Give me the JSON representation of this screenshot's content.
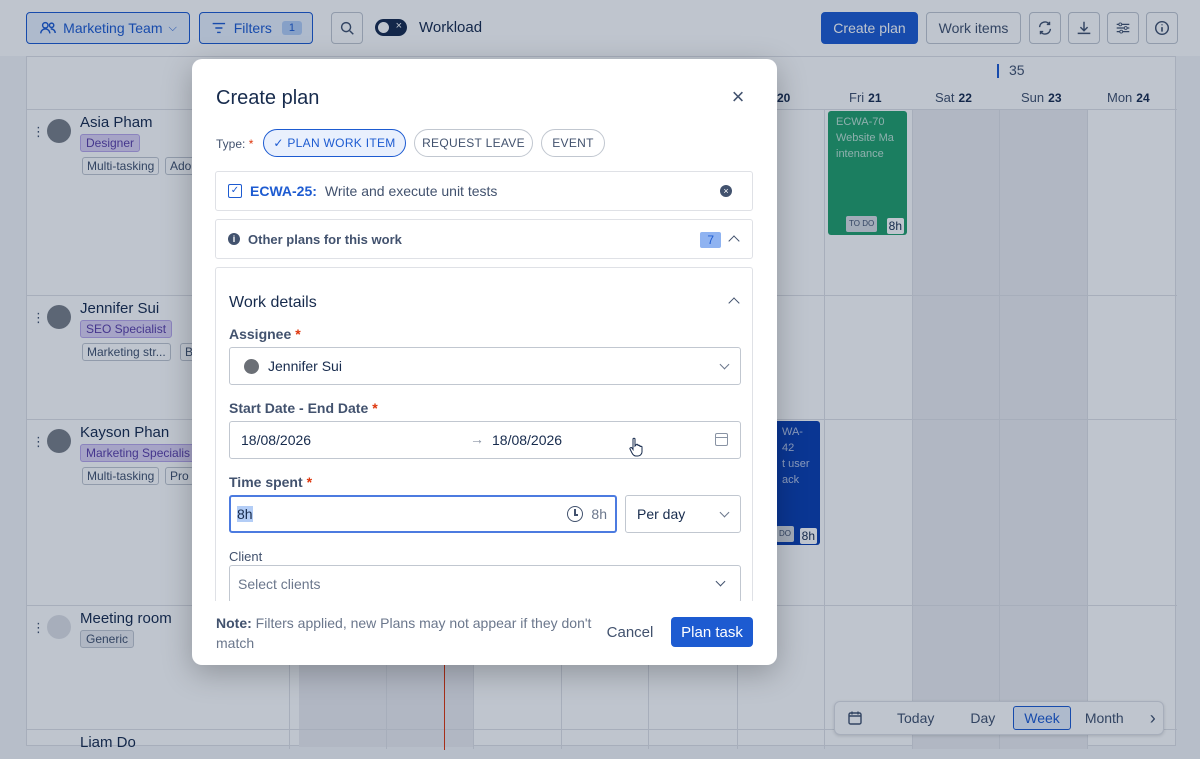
{
  "toolbar": {
    "team_label": "Marketing Team",
    "filters_label": "Filters",
    "filters_count": "1",
    "workload_label": "Workload",
    "create_plan_label": "Create plan",
    "work_items_label": "Work items"
  },
  "calendar": {
    "week_number": "35",
    "days": [
      {
        "name": "",
        "num": "20"
      },
      {
        "name": "Fri",
        "num": "21"
      },
      {
        "name": "Sat",
        "num": "22"
      },
      {
        "name": "Sun",
        "num": "23"
      },
      {
        "name": "Mon",
        "num": "24"
      }
    ],
    "people": [
      {
        "name": "Asia Pham",
        "role": "Designer",
        "skills": [
          "Multi-tasking",
          "Ado"
        ]
      },
      {
        "name": "Jennifer Sui",
        "role": "SEO Specialist",
        "skills": [
          "Marketing str...",
          "B"
        ]
      },
      {
        "name": "Kayson Phan",
        "role": "Marketing Specialis",
        "skills": [
          "Multi-tasking",
          "Pro"
        ]
      },
      {
        "name": "Meeting room",
        "role": "Generic",
        "skills": []
      },
      {
        "name": "Liam Do",
        "role": "",
        "skills": []
      }
    ],
    "cards": [
      {
        "key": "ECWA-70",
        "title": "Website Ma intenance",
        "status": "TO DO",
        "hours": "8h",
        "color": "#22a06b"
      },
      {
        "key": "WA-42",
        "title": "t user ack",
        "status": "DO",
        "hours": "8h",
        "color": "#0c3fb0"
      }
    ],
    "nav": {
      "today": "Today",
      "day": "Day",
      "week": "Week",
      "month": "Month"
    }
  },
  "modal": {
    "title": "Create plan",
    "type_label": "Type:",
    "types": [
      "✓ PLAN WORK ITEM",
      "REQUEST LEAVE",
      "EVENT"
    ],
    "work_item": {
      "key": "ECWA-25:",
      "title": "Write and execute unit tests"
    },
    "other_plans": {
      "label": "Other plans for this work",
      "count": "7"
    },
    "section_title": "Work details",
    "assignee_label": "Assignee",
    "assignee_value": "Jennifer Sui",
    "date_label": "Start Date - End Date",
    "start_date": "18/08/2026",
    "end_date": "18/08/2026",
    "time_label": "Time spent",
    "time_value": "8h",
    "time_suffix": "8h",
    "period_value": "Per day",
    "client_label": "Client",
    "client_placeholder": "Select clients",
    "note_bold": "Note:",
    "note_text": " Filters applied, new Plans may not appear if they don't match",
    "cancel_label": "Cancel",
    "submit_label": "Plan task"
  },
  "colors": {
    "accent": "#1d5bd1",
    "required": "#de350b"
  }
}
